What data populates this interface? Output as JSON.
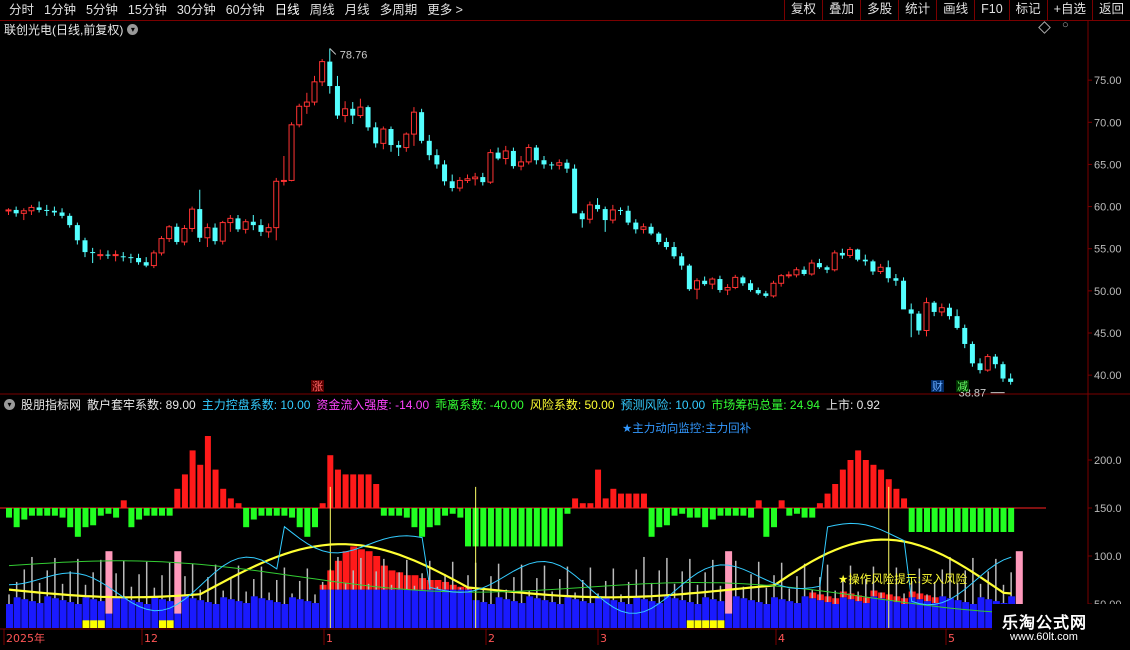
{
  "toolbar": {
    "periods": [
      "分时",
      "1分钟",
      "5分钟",
      "15分钟",
      "30分钟",
      "60分钟",
      "日线",
      "周线",
      "月线",
      "多周期",
      "更多 >"
    ],
    "buttons": [
      "复权",
      "叠加",
      "多股",
      "统计",
      "画线",
      "F10",
      "标记",
      "+自选",
      "返回"
    ]
  },
  "stock": {
    "title": "联创光电(日线,前复权)"
  },
  "main_chart": {
    "y_ticks": [
      "75.00",
      "70.00",
      "65.00",
      "60.00",
      "55.00",
      "50.00",
      "45.00",
      "40.00"
    ],
    "high_label": "78.76",
    "low_label": "38.87",
    "signals": [
      "涨",
      "财",
      "减"
    ]
  },
  "indicator": {
    "name": "股朋指标网",
    "params": [
      {
        "label": "散户套牢系数",
        "value": "89.00",
        "color": "#e8e8e8"
      },
      {
        "label": "主力控盘系数",
        "value": "10.00",
        "color": "#33ccff"
      },
      {
        "label": "资金流入强度",
        "value": "-14.00",
        "color": "#ff44ff"
      },
      {
        "label": "乖离系数",
        "value": "-40.00",
        "color": "#33ff33"
      },
      {
        "label": "风险系数",
        "value": "50.00",
        "color": "#ffff33"
      },
      {
        "label": "预测风险",
        "value": "10.00",
        "color": "#33ccff"
      },
      {
        "label": "市场筹码总量",
        "value": "24.94",
        "color": "#33ff33"
      },
      {
        "label": "上市",
        "value": "0.92",
        "color": "#e8e8e8"
      }
    ],
    "annotation1": "★主力动向监控:主力回补",
    "annotation2": "★操作风险提示:买入风险",
    "y_ticks": [
      "200.0",
      "150.0",
      "100.0",
      "50.00"
    ]
  },
  "date_axis": [
    "2025年",
    "12",
    "1",
    "2",
    "3",
    "4",
    "5"
  ],
  "watermark": {
    "title": "乐淘公式网",
    "url": "www.60lt.com"
  },
  "colors": {
    "up": "#ff3333",
    "down": "#54ffff",
    "grid": "#7a0000",
    "axis_text": "#ccc"
  },
  "chart_data": {
    "type": "candlestick",
    "title": "联创光电(日线,前复权)",
    "ylim": [
      38,
      80
    ],
    "candles": [
      [
        59.5,
        59.8,
        59.0,
        59.6
      ],
      [
        59.6,
        60.0,
        58.8,
        59.2
      ],
      [
        59.2,
        59.8,
        58.4,
        59.5
      ],
      [
        59.5,
        60.2,
        59.0,
        59.9
      ],
      [
        59.9,
        60.6,
        59.3,
        59.6
      ],
      [
        59.6,
        60.2,
        58.9,
        59.5
      ],
      [
        59.5,
        60.0,
        58.9,
        59.3
      ],
      [
        59.3,
        59.8,
        58.6,
        58.9
      ],
      [
        58.9,
        59.2,
        57.5,
        57.8
      ],
      [
        57.8,
        58.1,
        55.5,
        56.0
      ],
      [
        56.0,
        56.3,
        54.0,
        54.6
      ],
      [
        54.6,
        55.1,
        53.3,
        54.5
      ],
      [
        54.3,
        54.9,
        53.7,
        54.3
      ],
      [
        54.3,
        54.8,
        53.8,
        54.2
      ],
      [
        54.2,
        54.8,
        53.5,
        54.3
      ],
      [
        54.1,
        54.6,
        53.5,
        54.0
      ],
      [
        54.0,
        54.4,
        53.3,
        53.9
      ],
      [
        53.9,
        54.4,
        53.1,
        53.4
      ],
      [
        53.4,
        54.0,
        52.8,
        53.0
      ],
      [
        53.0,
        54.8,
        52.7,
        54.5
      ],
      [
        54.5,
        56.5,
        54.2,
        56.2
      ],
      [
        56.2,
        57.8,
        55.8,
        57.6
      ],
      [
        57.6,
        58.0,
        55.5,
        55.8
      ],
      [
        55.8,
        57.8,
        55.4,
        57.4
      ],
      [
        57.4,
        60.0,
        57.0,
        59.7
      ],
      [
        59.7,
        62.0,
        55.8,
        56.3
      ],
      [
        56.3,
        58.0,
        55.2,
        57.5
      ],
      [
        57.5,
        58.0,
        55.5,
        55.9
      ],
      [
        55.9,
        58.3,
        55.5,
        58.1
      ],
      [
        58.1,
        59.0,
        57.0,
        58.6
      ],
      [
        58.6,
        59.0,
        57.0,
        57.3
      ],
      [
        57.3,
        58.5,
        56.8,
        58.2
      ],
      [
        58.2,
        59.0,
        57.2,
        57.8
      ],
      [
        57.8,
        58.5,
        56.5,
        57.0
      ],
      [
        57.0,
        58.0,
        56.3,
        57.5
      ],
      [
        57.5,
        63.4,
        56.0,
        63.0
      ],
      [
        63.0,
        66.0,
        62.5,
        63.1
      ],
      [
        63.1,
        70.0,
        63.0,
        69.7
      ],
      [
        69.7,
        72.2,
        69.4,
        71.9
      ],
      [
        71.9,
        73.5,
        71.0,
        72.4
      ],
      [
        72.4,
        75.5,
        72.0,
        74.8
      ],
      [
        74.8,
        77.5,
        74.3,
        77.2
      ],
      [
        77.2,
        78.76,
        73.4,
        74.3
      ],
      [
        74.3,
        75.5,
        70.4,
        70.8
      ],
      [
        70.8,
        72.5,
        70.0,
        71.6
      ],
      [
        71.6,
        72.4,
        69.8,
        70.8
      ],
      [
        70.8,
        72.8,
        70.5,
        71.8
      ],
      [
        71.8,
        72.0,
        69.0,
        69.4
      ],
      [
        69.4,
        70.0,
        67.0,
        67.5
      ],
      [
        67.5,
        69.5,
        66.8,
        69.2
      ],
      [
        69.2,
        69.5,
        66.5,
        67.3
      ],
      [
        67.3,
        67.8,
        66.0,
        67.0
      ],
      [
        67.0,
        68.8,
        66.5,
        68.6
      ],
      [
        68.6,
        71.8,
        67.2,
        71.2
      ],
      [
        71.2,
        71.6,
        67.5,
        67.8
      ],
      [
        67.8,
        68.5,
        65.5,
        66.1
      ],
      [
        66.1,
        66.8,
        64.5,
        65.0
      ],
      [
        65.0,
        65.5,
        62.5,
        63.0
      ],
      [
        63.0,
        63.8,
        61.8,
        62.2
      ],
      [
        62.2,
        63.5,
        61.8,
        63.1
      ],
      [
        63.1,
        63.8,
        62.8,
        63.3
      ],
      [
        63.3,
        64.0,
        62.5,
        63.5
      ],
      [
        63.5,
        64.0,
        62.5,
        62.9
      ],
      [
        62.9,
        66.8,
        62.7,
        66.4
      ],
      [
        66.4,
        67.0,
        65.5,
        65.7
      ],
      [
        65.7,
        67.2,
        65.0,
        66.6
      ],
      [
        66.6,
        67.0,
        64.5,
        64.8
      ],
      [
        64.8,
        66.0,
        64.3,
        65.3
      ],
      [
        65.3,
        67.4,
        65.0,
        67.0
      ],
      [
        67.0,
        67.3,
        65.0,
        65.5
      ],
      [
        65.5,
        66.0,
        64.5,
        65.0
      ],
      [
        65.0,
        65.3,
        64.4,
        64.9
      ],
      [
        64.9,
        65.6,
        64.4,
        65.2
      ],
      [
        65.2,
        65.6,
        64.0,
        64.5
      ],
      [
        64.5,
        65.0,
        63.0,
        59.2
      ],
      [
        59.2,
        59.5,
        57.5,
        58.5
      ],
      [
        58.5,
        60.6,
        58.0,
        60.2
      ],
      [
        60.2,
        61.0,
        59.4,
        59.7
      ],
      [
        59.7,
        60.0,
        57.0,
        58.4
      ],
      [
        58.4,
        60.2,
        58.0,
        59.6
      ],
      [
        59.6,
        59.9,
        59.0,
        59.5
      ],
      [
        59.5,
        60.1,
        57.8,
        58.1
      ],
      [
        58.1,
        58.5,
        56.8,
        57.3
      ],
      [
        57.3,
        58.0,
        56.8,
        57.6
      ],
      [
        57.6,
        58.0,
        56.6,
        56.8
      ],
      [
        56.8,
        57.0,
        55.5,
        55.8
      ],
      [
        55.8,
        56.3,
        54.9,
        55.2
      ],
      [
        55.2,
        55.8,
        53.8,
        54.1
      ],
      [
        54.1,
        54.5,
        52.5,
        53.0
      ],
      [
        53.0,
        53.2,
        50.0,
        50.2
      ],
      [
        50.2,
        51.5,
        49.0,
        51.2
      ],
      [
        51.2,
        51.7,
        50.6,
        50.8
      ],
      [
        50.8,
        51.6,
        50.2,
        51.4
      ],
      [
        51.4,
        51.8,
        49.8,
        50.1
      ],
      [
        50.1,
        50.8,
        49.5,
        50.4
      ],
      [
        50.4,
        51.9,
        50.2,
        51.6
      ],
      [
        51.6,
        51.8,
        50.6,
        50.9
      ],
      [
        50.9,
        51.3,
        49.9,
        50.1
      ],
      [
        50.1,
        50.4,
        49.5,
        49.7
      ],
      [
        49.7,
        50.0,
        49.2,
        49.4
      ],
      [
        49.4,
        51.2,
        49.2,
        50.9
      ],
      [
        50.9,
        52.0,
        50.5,
        51.8
      ],
      [
        51.8,
        52.3,
        51.5,
        51.9
      ],
      [
        51.9,
        52.8,
        51.6,
        52.5
      ],
      [
        52.5,
        52.9,
        51.8,
        52.0
      ],
      [
        52.0,
        53.7,
        51.8,
        53.3
      ],
      [
        53.3,
        53.8,
        52.6,
        52.8
      ],
      [
        52.8,
        53.0,
        52.1,
        52.5
      ],
      [
        52.5,
        54.8,
        52.3,
        54.5
      ],
      [
        54.5,
        55.0,
        53.8,
        54.2
      ],
      [
        54.2,
        55.2,
        53.9,
        54.9
      ],
      [
        54.9,
        55.0,
        53.5,
        53.7
      ],
      [
        53.7,
        54.3,
        53.0,
        53.5
      ],
      [
        53.5,
        53.7,
        51.9,
        52.3
      ],
      [
        52.3,
        53.2,
        52.0,
        52.8
      ],
      [
        52.8,
        53.6,
        51.0,
        51.5
      ],
      [
        51.5,
        52.0,
        50.6,
        51.2
      ],
      [
        51.2,
        51.6,
        49.0,
        47.8
      ],
      [
        47.8,
        48.5,
        44.5,
        47.3
      ],
      [
        47.3,
        47.6,
        44.8,
        45.3
      ],
      [
        45.3,
        49.2,
        44.6,
        48.6
      ],
      [
        48.6,
        48.8,
        47.0,
        47.5
      ],
      [
        47.5,
        48.5,
        47.0,
        48.0
      ],
      [
        48.0,
        48.5,
        46.6,
        47.0
      ],
      [
        47.0,
        47.8,
        45.4,
        45.6
      ],
      [
        45.6,
        46.0,
        43.2,
        43.7
      ],
      [
        43.7,
        44.0,
        41.0,
        41.4
      ],
      [
        41.4,
        42.0,
        40.2,
        40.6
      ],
      [
        40.6,
        42.5,
        40.4,
        42.2
      ],
      [
        42.2,
        42.5,
        40.8,
        41.3
      ],
      [
        41.3,
        41.6,
        39.2,
        39.6
      ],
      [
        39.6,
        40.2,
        38.87,
        39.2
      ]
    ]
  }
}
